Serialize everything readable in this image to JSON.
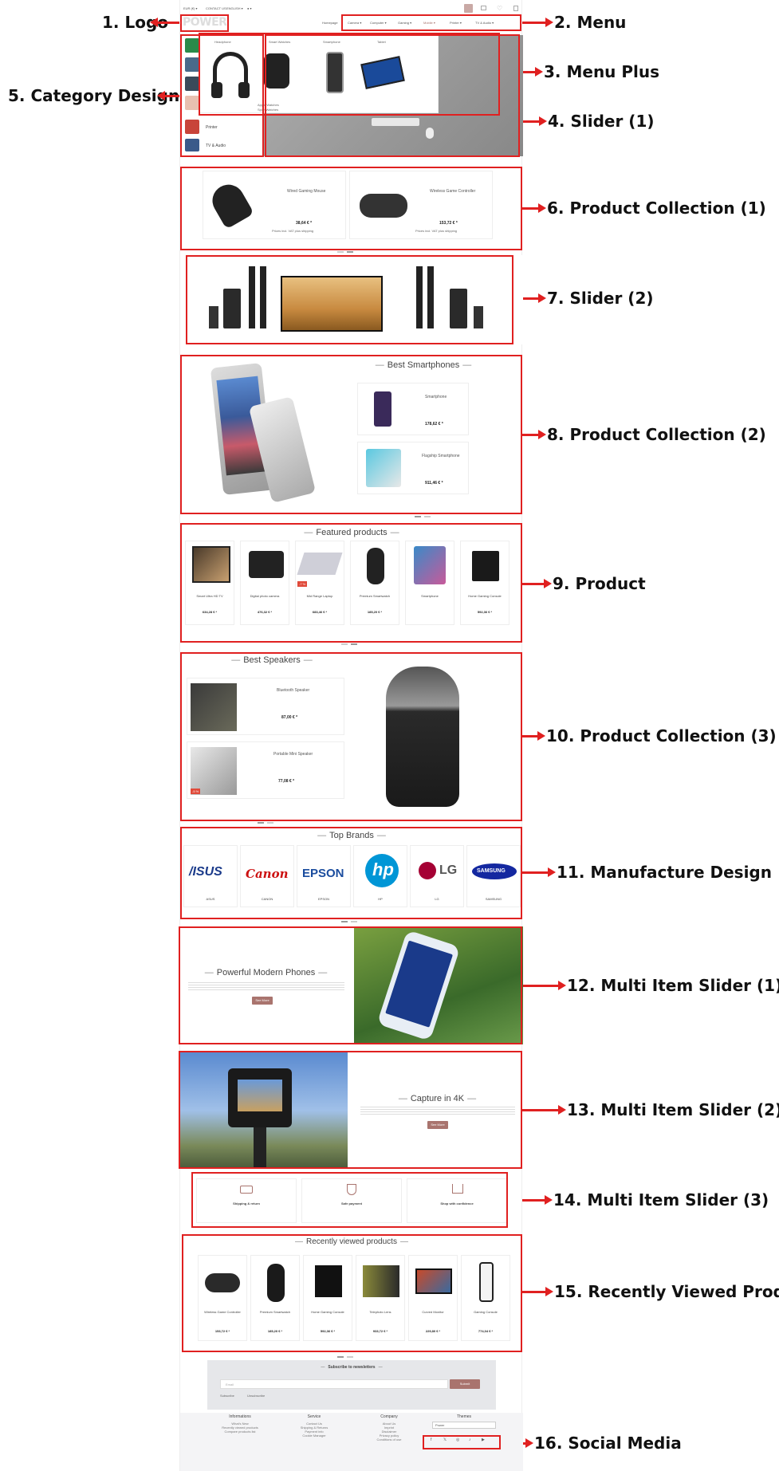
{
  "callouts": {
    "c1": "1. Logo",
    "c2": "2. Menu",
    "c3": "3. Menu Plus",
    "c4": "4. Slider (1)",
    "c5": "5. Category Design",
    "c6": "6. Product Collection (1)",
    "c7": "7. Slider (2)",
    "c8": "8. Product Collection (2)",
    "c9": "9. Product",
    "c10": "10. Product Collection (3)",
    "c11": "11. Manufacture Design",
    "c12": "12. Multi Item Slider (1)",
    "c13": "13. Multi Item Slider (2)",
    "c14": "14. Multi Item Slider (3)",
    "c15": "15. Recently Viewed Product",
    "c16": "16. Social Media"
  },
  "colors": {
    "annotation": "#e02020",
    "accent": "#a9746e"
  },
  "topbar": {
    "currency": "EUR (€) ▾",
    "contact": "CONTACT US",
    "lang": "ENGLISH ▾",
    "account": "● ▾"
  },
  "logo": "POWER",
  "menu": [
    "Homepage",
    "Camera ▾",
    "Computer ▾",
    "Gaming ▾",
    "Mobile ▾",
    "Printer ▾",
    "TV & Audio ▾"
  ],
  "menu_plus": [
    "Headphone",
    "Smart Watches",
    "Smartphone",
    "Tablet"
  ],
  "menu_plus_links": [
    "Apple Watches",
    "Sport Watches"
  ],
  "categories": [
    "Printer",
    "TV & Audio"
  ],
  "collection1": [
    {
      "name": "Wired Gaming Mouse",
      "price": "38,64 € *",
      "note": "Prices incl. VAT plus shipping"
    },
    {
      "name": "Wireless Game Controller",
      "price": "153,72 € *",
      "note": "Prices incl. VAT plus shipping"
    }
  ],
  "collection2": {
    "title": "Best Smartphones",
    "items": [
      {
        "name": "Smartphone",
        "price": "178,62 € *"
      },
      {
        "name": "Flagship Smartphone",
        "price": "911,46 € *"
      }
    ]
  },
  "featured": {
    "title": "Featured products",
    "items": [
      {
        "name": "Smart Ultra HD TV",
        "price": "634,28 € *"
      },
      {
        "name": "Digital photo camera",
        "price": "476,32 € *"
      },
      {
        "name": "Mid Range Laptop",
        "price": "683,46 € *",
        "badge": "-7 %"
      },
      {
        "name": "Premium Smartwatch",
        "price": "185,20 € *"
      },
      {
        "name": "Smartphone",
        "price": ""
      },
      {
        "name": "Home Gaming Console",
        "price": "592,36 € *"
      }
    ]
  },
  "speakers": {
    "title": "Best Speakers",
    "items": [
      {
        "name": "Bluetooth Speaker",
        "price": "87,00 € *"
      },
      {
        "name": "Portable Mini Speaker",
        "price": "77,08 € *",
        "badge": "-5 %"
      }
    ]
  },
  "brands": {
    "title": "Top Brands",
    "items": [
      {
        "logo": "/ISUS",
        "name": "ASUS",
        "color": "#1a3a8a"
      },
      {
        "logo": "Canon",
        "name": "CANON",
        "color": "#cc1111"
      },
      {
        "logo": "EPSON",
        "name": "EPSON",
        "color": "#1a4c9e"
      },
      {
        "logo": "hp",
        "name": "HP",
        "color": "#0096d6"
      },
      {
        "logo": "LG",
        "name": "LG",
        "color": "#a50034"
      },
      {
        "logo": "SAMSUNG",
        "name": "SAMSUNG",
        "color": "#1428a0"
      }
    ]
  },
  "slider_phones": {
    "title": "Powerful Modern Phones",
    "button": "See More"
  },
  "slider_4k": {
    "title": "Capture in 4K",
    "button": "See More"
  },
  "usp": [
    {
      "title": "Shipping & return"
    },
    {
      "title": "Safe payment"
    },
    {
      "title": "Shop with confidence"
    }
  ],
  "recent": {
    "title": "Recently viewed products",
    "items": [
      {
        "name": "Wireless Game Controller",
        "price": "153,72 € *"
      },
      {
        "name": "Premium Smartwatch",
        "price": "185,20 € *"
      },
      {
        "name": "Home Gaming Console",
        "price": "592,36 € *"
      },
      {
        "name": "Telephoto Lens",
        "price": "933,72 € *"
      },
      {
        "name": "Curved Monitor",
        "price": "229,80 € *"
      },
      {
        "name": "Gaming Console",
        "price": "774,04 € *"
      }
    ]
  },
  "newsletter": {
    "title": "Subscribe to newsletters",
    "placeholder": "Email",
    "button": "Submit",
    "opt1": "Subscribe",
    "opt2": "Unsubscribe"
  },
  "footer": {
    "cols": [
      {
        "title": "Informations",
        "links": [
          "What's New",
          "Recently viewed products",
          "Compare products list"
        ]
      },
      {
        "title": "Service",
        "links": [
          "Contact Us",
          "Shipping & Returns",
          "Payment info",
          "Cookie Manager"
        ]
      },
      {
        "title": "Company",
        "links": [
          "About Us",
          "Imprint",
          "Disclaimer",
          "Privacy policy",
          "Conditions of use"
        ]
      }
    ],
    "themes": "Themes",
    "theme_select": "Power"
  }
}
